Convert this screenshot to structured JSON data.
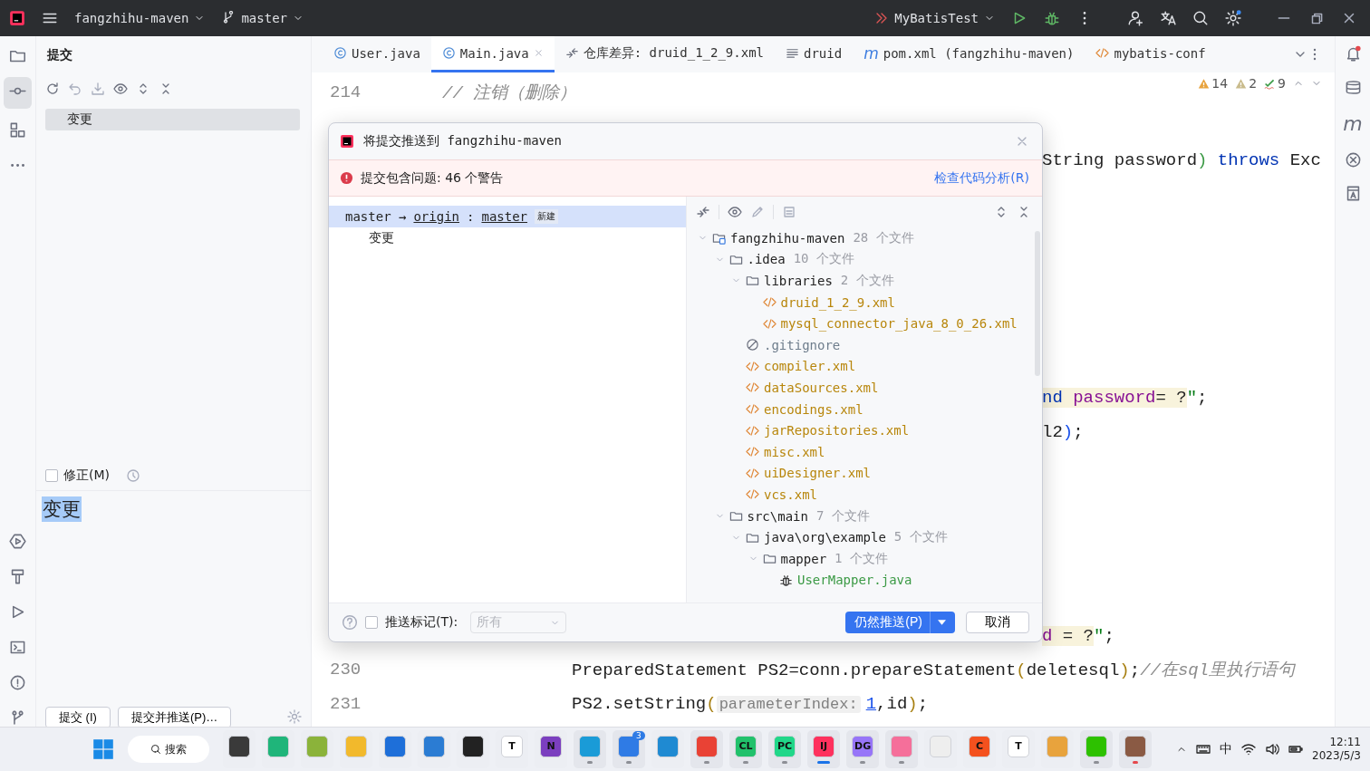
{
  "top_bar": {
    "project": "fangzhihu-maven",
    "branch": "master",
    "run_config": "MyBatisTest",
    "settings_badge": true
  },
  "commit_panel": {
    "title": "提交",
    "changes": [
      {
        "label": "变更",
        "selected": true
      }
    ],
    "amend": {
      "label": "修正(M)",
      "checked": false
    },
    "message": {
      "value": "变更",
      "text_selected": true
    },
    "buttons": [
      {
        "label": "提交 (I)"
      },
      {
        "label": "提交并推送(P)…"
      }
    ]
  },
  "tabs": [
    {
      "label": "User.java",
      "kind": "java",
      "selected": false,
      "closable": false
    },
    {
      "label": "Main.java",
      "kind": "java",
      "selected": true,
      "closable": true
    },
    {
      "label": "仓库差异: druid_1_2_9.xml",
      "kind": "diff",
      "selected": false,
      "closable": false
    },
    {
      "label": "druid",
      "kind": "text",
      "selected": false,
      "closable": false
    },
    {
      "label": "pom.xml (fangzhihu-maven)",
      "kind": "maven",
      "glyph": "m",
      "selected": false,
      "closable": false
    },
    {
      "label": "mybatis-conf",
      "kind": "xml",
      "selected": false,
      "closable": false
    }
  ],
  "inspections": [
    {
      "kind": "warning",
      "count": "14"
    },
    {
      "kind": "weak-warning",
      "count": "2"
    },
    {
      "kind": "typo",
      "count": "9"
    }
  ],
  "code": [
    {
      "number": "214",
      "kind": "comment",
      "segments": [
        {
          "text": "// 注销（删除）",
          "kind": "comment"
        }
      ]
    },
    {
      "kind": "blank"
    },
    {
      "kind": "fragment",
      "segments": [
        {
          "text": "String password",
          "kind": "plain"
        },
        {
          "text": ")",
          "kind": "paren-green"
        },
        {
          "text": " throws ",
          "kind": "keyword"
        },
        {
          "text": "Exc",
          "kind": "plain"
        }
      ]
    },
    {
      "kind": "blank"
    },
    {
      "kind": "blank"
    },
    {
      "kind": "blank"
    },
    {
      "kind": "blank"
    },
    {
      "kind": "blank"
    },
    {
      "kind": "blank"
    },
    {
      "kind": "fragment",
      "segments": [
        {
          "text": "nd ",
          "kind": "sql-keyword"
        },
        {
          "text": "password",
          "kind": "sql-name"
        },
        {
          "text": "= ?",
          "kind": "sql"
        },
        {
          "text": "\"",
          "kind": "string"
        },
        {
          "text": ";",
          "kind": "plain"
        }
      ]
    },
    {
      "kind": "fragment",
      "segments": [
        {
          "text": "l2",
          "kind": "plain"
        },
        {
          "text": ")",
          "kind": "paren-blue"
        },
        {
          "text": ";",
          "kind": "plain"
        }
      ]
    },
    {
      "kind": "blank"
    },
    {
      "kind": "blank"
    },
    {
      "kind": "blank"
    },
    {
      "kind": "blank"
    },
    {
      "kind": "blank"
    },
    {
      "kind": "fragment",
      "segments": [
        {
          "text": "d",
          "kind": "sql-name"
        },
        {
          "text": " = ?",
          "kind": "sql"
        },
        {
          "text": "\"",
          "kind": "string"
        },
        {
          "text": ";",
          "kind": "plain"
        }
      ]
    },
    {
      "number": "230",
      "kind": "code",
      "segments": [
        {
          "text": "PreparedStatement PS2=conn.prepareStatement",
          "kind": "plain"
        },
        {
          "text": "(",
          "kind": "paren-yellow"
        },
        {
          "text": "deletesql",
          "kind": "plain"
        },
        {
          "text": ")",
          "kind": "paren-yellow"
        },
        {
          "text": ";",
          "kind": "plain"
        },
        {
          "text": "//在sql里执行语句",
          "kind": "comment"
        }
      ]
    },
    {
      "number": "231",
      "kind": "code",
      "segments": [
        {
          "text": "PS2.setString",
          "kind": "plain"
        },
        {
          "text": "(",
          "kind": "paren-yellow"
        },
        {
          "text": "parameterIndex:",
          "kind": "hint"
        },
        {
          "text": "1",
          "kind": "number"
        },
        {
          "text": ",id",
          "kind": "plain"
        },
        {
          "text": ")",
          "kind": "paren-yellow"
        },
        {
          "text": ";",
          "kind": "plain"
        }
      ]
    }
  ],
  "right_strip": {
    "notifications_unread": true,
    "maven_glyph": "m"
  },
  "dialog": {
    "title": "将提交推送到 fangzhihu-maven",
    "warning": "提交包含问题: 46 个警告",
    "warning_link": "检查代码分析(R)",
    "branch": {
      "source": "master →",
      "remote": "origin",
      "separator": ":",
      "target": "master",
      "tag": "新建",
      "selected": true,
      "child": "变更"
    },
    "tree": [
      {
        "name": "fangzhihu-maven",
        "kind": "module",
        "count": "28 个文件",
        "expanded": true,
        "children": [
          {
            "name": ".idea",
            "kind": "folder",
            "count": "10 个文件",
            "expanded": true,
            "children": [
              {
                "name": "libraries",
                "kind": "folder",
                "count": "2 个文件",
                "expanded": true,
                "children": [
                  {
                    "name": "druid_1_2_9.xml",
                    "kind": "xml"
                  },
                  {
                    "name": "mysql_connector_java_8_0_26.xml",
                    "kind": "xml"
                  }
                ]
              },
              {
                "name": ".gitignore",
                "kind": "ignore"
              },
              {
                "name": "compiler.xml",
                "kind": "xml"
              },
              {
                "name": "dataSources.xml",
                "kind": "xml"
              },
              {
                "name": "encodings.xml",
                "kind": "xml"
              },
              {
                "name": "jarRepositories.xml",
                "kind": "xml"
              },
              {
                "name": "misc.xml",
                "kind": "xml"
              },
              {
                "name": "uiDesigner.xml",
                "kind": "xml"
              },
              {
                "name": "vcs.xml",
                "kind": "xml"
              }
            ]
          },
          {
            "name": "src\\main",
            "kind": "folder",
            "count": "7 个文件",
            "expanded": true,
            "children": [
              {
                "name": "java\\org\\example",
                "kind": "folder",
                "count": "5 个文件",
                "expanded": true,
                "children": [
                  {
                    "name": "mapper",
                    "kind": "folder",
                    "count": "1 个文件",
                    "expanded": true,
                    "children": [
                      {
                        "name": "UserMapper.java",
                        "kind": "mybatis"
                      }
                    ]
                  }
                ]
              }
            ]
          }
        ]
      }
    ],
    "push_tags": {
      "label": "推送标记(T):",
      "checked": false
    },
    "tags_select": {
      "value": "所有",
      "disabled": true
    },
    "primary_button": "仍然推送(P)",
    "cancel_button": "取消"
  },
  "taskbar": {
    "search": "搜索",
    "apps": [
      {
        "color": "#3a3a3a",
        "running": false
      },
      {
        "color": "#1fb57a",
        "running": false
      },
      {
        "color": "#8bb33a",
        "running": false
      },
      {
        "color": "#f2b92c",
        "running": false
      },
      {
        "color": "#1e6fd9",
        "running": false
      },
      {
        "color": "#2b7cd3",
        "running": false
      },
      {
        "color": "#222222",
        "running": false
      },
      {
        "color": "#ffffff",
        "label": "T",
        "running": false
      },
      {
        "color": "#7b3fbf",
        "label": "N",
        "running": false
      },
      {
        "color": "#1a9bd7",
        "running": true
      },
      {
        "color": "#2f7be5",
        "badge": "3",
        "running": true
      },
      {
        "color": "#1f8ad2",
        "running": false
      },
      {
        "color": "#e94235",
        "running": true
      },
      {
        "color": "#21c16b",
        "label": "CL",
        "running": true
      },
      {
        "color": "#21d789",
        "label": "PC",
        "running": true
      },
      {
        "color": "#fe315d",
        "label": "IJ",
        "running": true,
        "active": true
      },
      {
        "color": "#9775f8",
        "label": "DG",
        "running": true
      },
      {
        "color": "#f56f9a",
        "running": true
      },
      {
        "color": "#eeeeee",
        "running": false
      },
      {
        "color": "#f4511e",
        "label": "C",
        "running": false
      },
      {
        "color": "#ffffff",
        "label": "T",
        "running": false
      },
      {
        "color": "#e8a33d",
        "running": false
      },
      {
        "color": "#2dc100",
        "running": true
      },
      {
        "color": "#8a5a44",
        "running": true,
        "active_red": true
      }
    ],
    "ime": "中",
    "time": "12:11",
    "date": "2023/5/3"
  }
}
